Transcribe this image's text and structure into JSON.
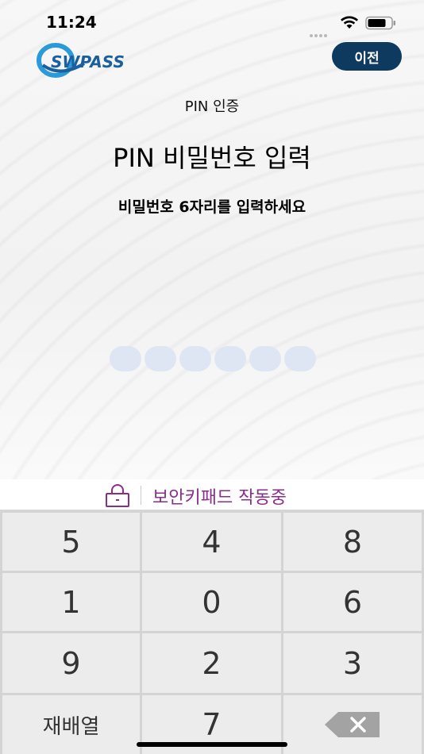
{
  "status_bar": {
    "time": "11:24"
  },
  "header": {
    "logo_text": "SWPASS",
    "prev_label": "이전"
  },
  "auth": {
    "subtitle": "PIN 인증",
    "title": "PIN 비밀번호 입력",
    "instruction": "비밀번호 6자리를 입력하세요",
    "pin_length": 6
  },
  "secure_keypad": {
    "label": "보안키패드 작동중",
    "accent": "#8b2d8b"
  },
  "keypad": {
    "rows": [
      [
        "5",
        "4",
        "8"
      ],
      [
        "1",
        "0",
        "6"
      ],
      [
        "9",
        "2",
        "3"
      ],
      [
        "재배열",
        "7",
        "backspace"
      ]
    ],
    "shuffle_label": "재배열"
  },
  "colors": {
    "prev_button": "#0e3a5f",
    "pin_dot": "#dfe6f3",
    "logo": "#1b5f9e"
  }
}
